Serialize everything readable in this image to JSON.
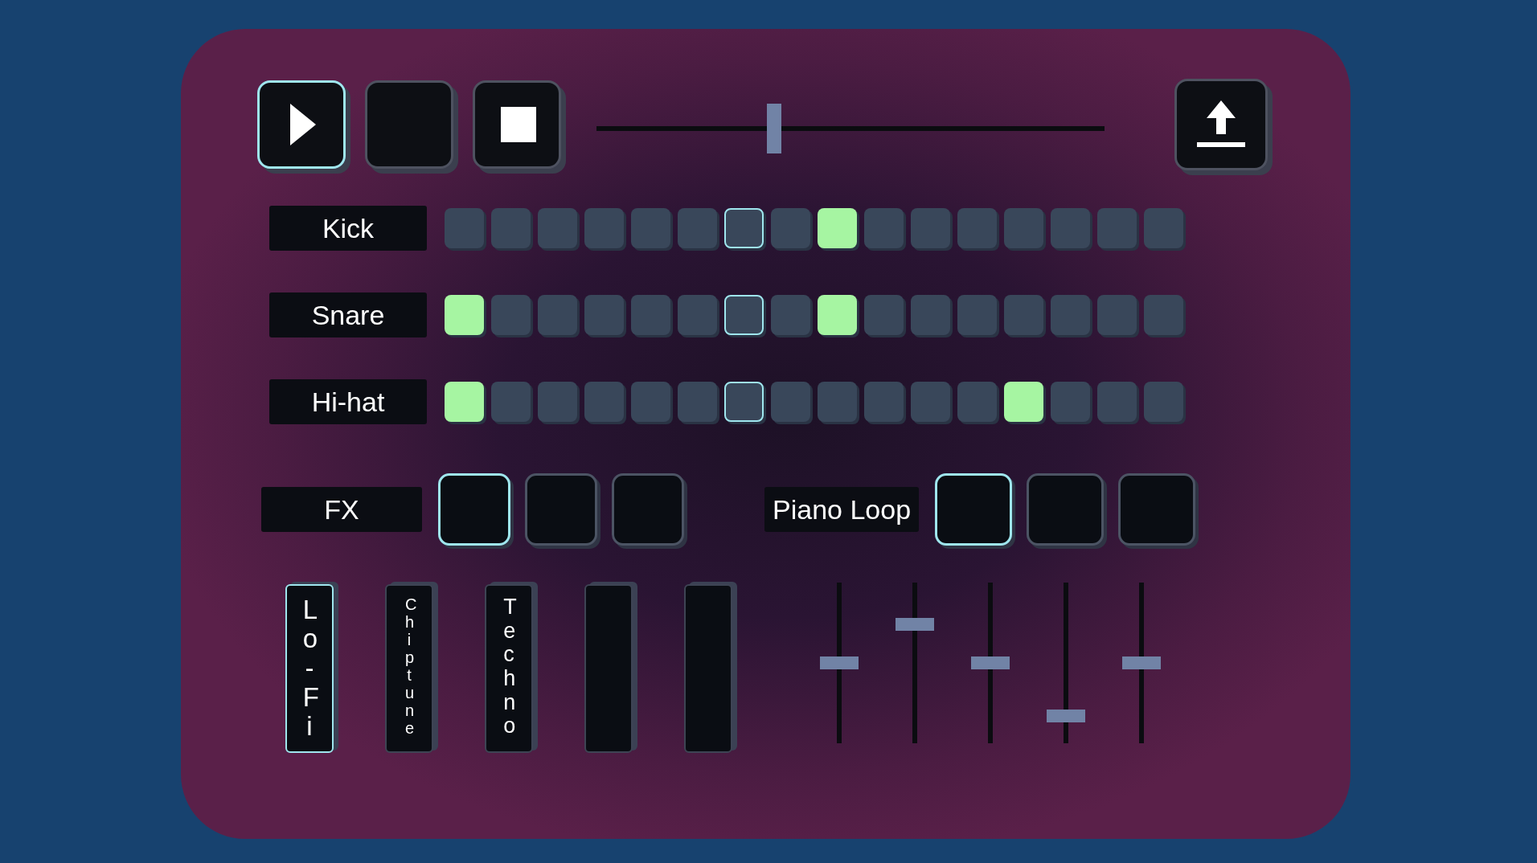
{
  "transport": {
    "buttons": [
      {
        "kind": "play",
        "selected": true
      },
      {
        "kind": "blank",
        "selected": false
      },
      {
        "kind": "stop",
        "selected": false
      }
    ],
    "position_slider": {
      "level": 0.34
    }
  },
  "tracks": [
    {
      "name": "Kick",
      "steps": [
        {
          "on": false,
          "current": false
        },
        {
          "on": false,
          "current": false
        },
        {
          "on": false,
          "current": false
        },
        {
          "on": false,
          "current": false
        },
        {
          "on": false,
          "current": false
        },
        {
          "on": false,
          "current": false
        },
        {
          "on": false,
          "current": true
        },
        {
          "on": false,
          "current": false
        },
        {
          "on": true,
          "current": false
        },
        {
          "on": false,
          "current": false
        },
        {
          "on": false,
          "current": false
        },
        {
          "on": false,
          "current": false
        },
        {
          "on": false,
          "current": false
        },
        {
          "on": false,
          "current": false
        },
        {
          "on": false,
          "current": false
        },
        {
          "on": false,
          "current": false
        }
      ]
    },
    {
      "name": "Snare",
      "steps": [
        {
          "on": true,
          "current": false
        },
        {
          "on": false,
          "current": false
        },
        {
          "on": false,
          "current": false
        },
        {
          "on": false,
          "current": false
        },
        {
          "on": false,
          "current": false
        },
        {
          "on": false,
          "current": false
        },
        {
          "on": false,
          "current": true
        },
        {
          "on": false,
          "current": false
        },
        {
          "on": true,
          "current": false
        },
        {
          "on": false,
          "current": false
        },
        {
          "on": false,
          "current": false
        },
        {
          "on": false,
          "current": false
        },
        {
          "on": false,
          "current": false
        },
        {
          "on": false,
          "current": false
        },
        {
          "on": false,
          "current": false
        },
        {
          "on": false,
          "current": false
        }
      ]
    },
    {
      "name": "Hi-hat",
      "steps": [
        {
          "on": true,
          "current": false
        },
        {
          "on": false,
          "current": false
        },
        {
          "on": false,
          "current": false
        },
        {
          "on": false,
          "current": false
        },
        {
          "on": false,
          "current": false
        },
        {
          "on": false,
          "current": false
        },
        {
          "on": false,
          "current": true
        },
        {
          "on": false,
          "current": false
        },
        {
          "on": false,
          "current": false
        },
        {
          "on": false,
          "current": false
        },
        {
          "on": false,
          "current": false
        },
        {
          "on": false,
          "current": false
        },
        {
          "on": true,
          "current": false
        },
        {
          "on": false,
          "current": false
        },
        {
          "on": false,
          "current": false
        },
        {
          "on": false,
          "current": false
        }
      ]
    }
  ],
  "fx": {
    "label": "FX",
    "pads": [
      {
        "selected": true
      },
      {
        "selected": false
      },
      {
        "selected": false
      }
    ]
  },
  "piano_loop": {
    "label": "Piano Loop",
    "pads": [
      {
        "selected": true
      },
      {
        "selected": false
      },
      {
        "selected": false
      }
    ]
  },
  "presets": [
    {
      "label": "Lo-Fi",
      "selected": true
    },
    {
      "label": "Chiptune",
      "selected": false
    },
    {
      "label": "Techno",
      "selected": false
    },
    {
      "selected": false
    },
    {
      "selected": false
    }
  ],
  "faders": [
    {
      "level": 0.5
    },
    {
      "level": 0.74
    },
    {
      "level": 0.5
    },
    {
      "level": 0.17
    },
    {
      "level": 0.5
    }
  ]
}
